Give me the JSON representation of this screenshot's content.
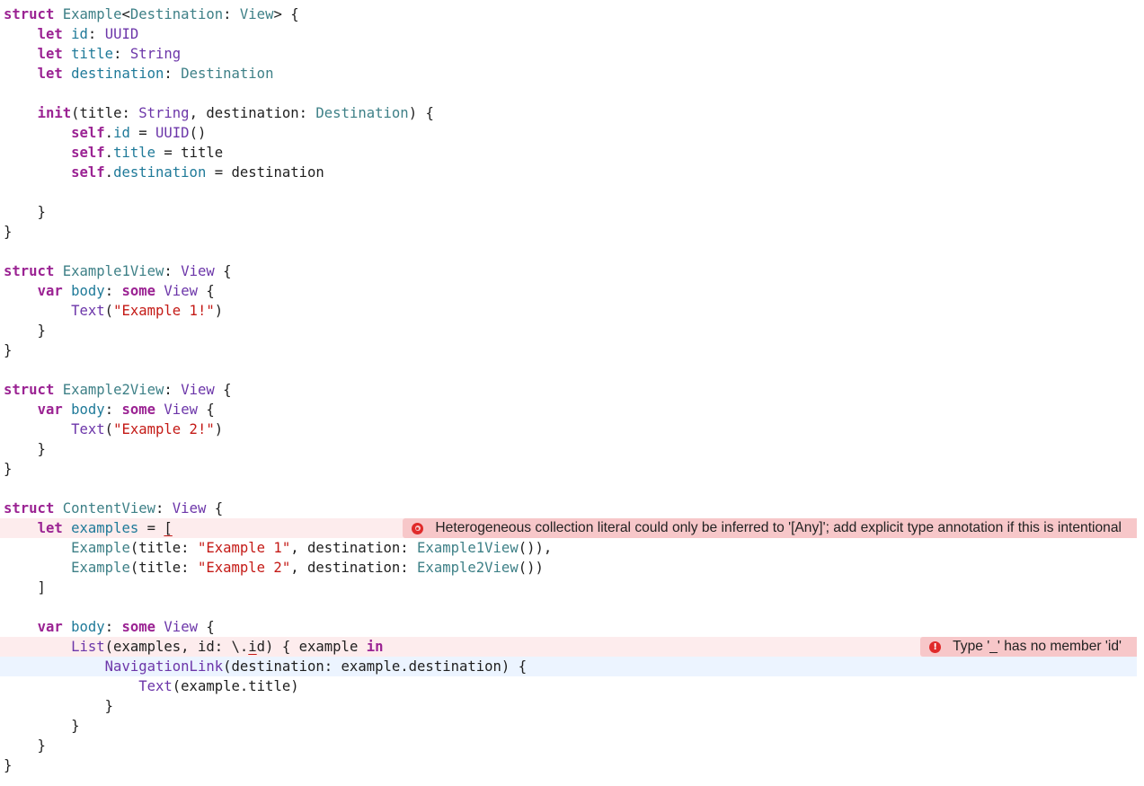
{
  "colors": {
    "keyword": "#9b2393",
    "type": "#3e8087",
    "property": "#1f7a99",
    "function": "#6c36a9",
    "string": "#c41a16",
    "plain": "#1f1f1f",
    "error_line_bg": "#fdeced",
    "current_line_bg": "#ecf4ff",
    "error_badge_bg": "#f7c7c9",
    "error_icon": "#e02a2a"
  },
  "code_lines": [
    {
      "tokens": [
        {
          "t": "kw",
          "v": "struct"
        },
        {
          "t": "plain",
          "v": " "
        },
        {
          "t": "type",
          "v": "Example"
        },
        {
          "t": "plain",
          "v": "<"
        },
        {
          "t": "type",
          "v": "Destination"
        },
        {
          "t": "plain",
          "v": ": "
        },
        {
          "t": "type",
          "v": "View"
        },
        {
          "t": "plain",
          "v": "> {"
        }
      ]
    },
    {
      "tokens": [
        {
          "t": "plain",
          "v": "    "
        },
        {
          "t": "kw",
          "v": "let"
        },
        {
          "t": "plain",
          "v": " "
        },
        {
          "t": "prop",
          "v": "id"
        },
        {
          "t": "plain",
          "v": ": "
        },
        {
          "t": "fn",
          "v": "UUID"
        }
      ]
    },
    {
      "tokens": [
        {
          "t": "plain",
          "v": "    "
        },
        {
          "t": "kw",
          "v": "let"
        },
        {
          "t": "plain",
          "v": " "
        },
        {
          "t": "prop",
          "v": "title"
        },
        {
          "t": "plain",
          "v": ": "
        },
        {
          "t": "fn",
          "v": "String"
        }
      ]
    },
    {
      "tokens": [
        {
          "t": "plain",
          "v": "    "
        },
        {
          "t": "kw",
          "v": "let"
        },
        {
          "t": "plain",
          "v": " "
        },
        {
          "t": "prop",
          "v": "destination"
        },
        {
          "t": "plain",
          "v": ": "
        },
        {
          "t": "type",
          "v": "Destination"
        }
      ]
    },
    {
      "tokens": []
    },
    {
      "tokens": [
        {
          "t": "plain",
          "v": "    "
        },
        {
          "t": "kw",
          "v": "init"
        },
        {
          "t": "plain",
          "v": "(title: "
        },
        {
          "t": "fn",
          "v": "String"
        },
        {
          "t": "plain",
          "v": ", destination: "
        },
        {
          "t": "type",
          "v": "Destination"
        },
        {
          "t": "plain",
          "v": ") {"
        }
      ]
    },
    {
      "tokens": [
        {
          "t": "plain",
          "v": "        "
        },
        {
          "t": "kw",
          "v": "self"
        },
        {
          "t": "plain",
          "v": "."
        },
        {
          "t": "prop",
          "v": "id"
        },
        {
          "t": "plain",
          "v": " = "
        },
        {
          "t": "fn",
          "v": "UUID"
        },
        {
          "t": "plain",
          "v": "()"
        }
      ]
    },
    {
      "tokens": [
        {
          "t": "plain",
          "v": "        "
        },
        {
          "t": "kw",
          "v": "self"
        },
        {
          "t": "plain",
          "v": "."
        },
        {
          "t": "prop",
          "v": "title"
        },
        {
          "t": "plain",
          "v": " = title"
        }
      ]
    },
    {
      "tokens": [
        {
          "t": "plain",
          "v": "        "
        },
        {
          "t": "kw",
          "v": "self"
        },
        {
          "t": "plain",
          "v": "."
        },
        {
          "t": "prop",
          "v": "destination"
        },
        {
          "t": "plain",
          "v": " = destination"
        }
      ]
    },
    {
      "tokens": []
    },
    {
      "tokens": [
        {
          "t": "plain",
          "v": "    }"
        }
      ]
    },
    {
      "tokens": [
        {
          "t": "plain",
          "v": "}"
        }
      ]
    },
    {
      "tokens": []
    },
    {
      "tokens": [
        {
          "t": "kw",
          "v": "struct"
        },
        {
          "t": "plain",
          "v": " "
        },
        {
          "t": "type",
          "v": "Example1View"
        },
        {
          "t": "plain",
          "v": ": "
        },
        {
          "t": "fn",
          "v": "View"
        },
        {
          "t": "plain",
          "v": " {"
        }
      ]
    },
    {
      "tokens": [
        {
          "t": "plain",
          "v": "    "
        },
        {
          "t": "kw",
          "v": "var"
        },
        {
          "t": "plain",
          "v": " "
        },
        {
          "t": "prop",
          "v": "body"
        },
        {
          "t": "plain",
          "v": ": "
        },
        {
          "t": "kw",
          "v": "some"
        },
        {
          "t": "plain",
          "v": " "
        },
        {
          "t": "fn",
          "v": "View"
        },
        {
          "t": "plain",
          "v": " {"
        }
      ]
    },
    {
      "tokens": [
        {
          "t": "plain",
          "v": "        "
        },
        {
          "t": "fn",
          "v": "Text"
        },
        {
          "t": "plain",
          "v": "("
        },
        {
          "t": "str",
          "v": "\"Example 1!\""
        },
        {
          "t": "plain",
          "v": ")"
        }
      ]
    },
    {
      "tokens": [
        {
          "t": "plain",
          "v": "    }"
        }
      ]
    },
    {
      "tokens": [
        {
          "t": "plain",
          "v": "}"
        }
      ]
    },
    {
      "tokens": []
    },
    {
      "tokens": [
        {
          "t": "kw",
          "v": "struct"
        },
        {
          "t": "plain",
          "v": " "
        },
        {
          "t": "type",
          "v": "Example2View"
        },
        {
          "t": "plain",
          "v": ": "
        },
        {
          "t": "fn",
          "v": "View"
        },
        {
          "t": "plain",
          "v": " {"
        }
      ]
    },
    {
      "tokens": [
        {
          "t": "plain",
          "v": "    "
        },
        {
          "t": "kw",
          "v": "var"
        },
        {
          "t": "plain",
          "v": " "
        },
        {
          "t": "prop",
          "v": "body"
        },
        {
          "t": "plain",
          "v": ": "
        },
        {
          "t": "kw",
          "v": "some"
        },
        {
          "t": "plain",
          "v": " "
        },
        {
          "t": "fn",
          "v": "View"
        },
        {
          "t": "plain",
          "v": " {"
        }
      ]
    },
    {
      "tokens": [
        {
          "t": "plain",
          "v": "        "
        },
        {
          "t": "fn",
          "v": "Text"
        },
        {
          "t": "plain",
          "v": "("
        },
        {
          "t": "str",
          "v": "\"Example 2!\""
        },
        {
          "t": "plain",
          "v": ")"
        }
      ]
    },
    {
      "tokens": [
        {
          "t": "plain",
          "v": "    }"
        }
      ]
    },
    {
      "tokens": [
        {
          "t": "plain",
          "v": "}"
        }
      ]
    },
    {
      "tokens": []
    },
    {
      "tokens": [
        {
          "t": "kw",
          "v": "struct"
        },
        {
          "t": "plain",
          "v": " "
        },
        {
          "t": "type",
          "v": "ContentView"
        },
        {
          "t": "plain",
          "v": ": "
        },
        {
          "t": "fn",
          "v": "View"
        },
        {
          "t": "plain",
          "v": " {"
        }
      ]
    },
    {
      "state": "error",
      "tokens": [
        {
          "t": "plain",
          "v": "    "
        },
        {
          "t": "kw",
          "v": "let"
        },
        {
          "t": "plain",
          "v": " "
        },
        {
          "t": "prop",
          "v": "examples"
        },
        {
          "t": "plain",
          "v": " = "
        },
        {
          "t": "cursor",
          "v": "["
        }
      ],
      "annotation": {
        "icon": "error-circle-icon",
        "text": "Heterogeneous collection literal could only be inferred to '[Any]'; add explicit type annotation if this is intentional"
      }
    },
    {
      "tokens": [
        {
          "t": "plain",
          "v": "        "
        },
        {
          "t": "type",
          "v": "Example"
        },
        {
          "t": "plain",
          "v": "(title: "
        },
        {
          "t": "str",
          "v": "\"Example 1\""
        },
        {
          "t": "plain",
          "v": ", destination: "
        },
        {
          "t": "type",
          "v": "Example1View"
        },
        {
          "t": "plain",
          "v": "()),"
        }
      ]
    },
    {
      "tokens": [
        {
          "t": "plain",
          "v": "        "
        },
        {
          "t": "type",
          "v": "Example"
        },
        {
          "t": "plain",
          "v": "(title: "
        },
        {
          "t": "str",
          "v": "\"Example 2\""
        },
        {
          "t": "plain",
          "v": ", destination: "
        },
        {
          "t": "type",
          "v": "Example2View"
        },
        {
          "t": "plain",
          "v": "())"
        }
      ]
    },
    {
      "tokens": [
        {
          "t": "plain",
          "v": "    ]"
        }
      ]
    },
    {
      "tokens": []
    },
    {
      "tokens": [
        {
          "t": "plain",
          "v": "    "
        },
        {
          "t": "kw",
          "v": "var"
        },
        {
          "t": "plain",
          "v": " "
        },
        {
          "t": "prop",
          "v": "body"
        },
        {
          "t": "plain",
          "v": ": "
        },
        {
          "t": "kw",
          "v": "some"
        },
        {
          "t": "plain",
          "v": " "
        },
        {
          "t": "fn",
          "v": "View"
        },
        {
          "t": "plain",
          "v": " {"
        }
      ]
    },
    {
      "state": "error",
      "tokens": [
        {
          "t": "plain",
          "v": "        "
        },
        {
          "t": "fn",
          "v": "List"
        },
        {
          "t": "plain",
          "v": "(examples, id: \\."
        },
        {
          "t": "cursor",
          "v": "i"
        },
        {
          "t": "plain",
          "v": "d) { example "
        },
        {
          "t": "kw2",
          "v": "in"
        }
      ],
      "annotation": {
        "icon": "error-exclamation-icon",
        "text": "Type '_' has no member 'id'"
      }
    },
    {
      "state": "current",
      "tokens": [
        {
          "t": "plain",
          "v": "            "
        },
        {
          "t": "fn",
          "v": "NavigationLink"
        },
        {
          "t": "plain",
          "v": "(destination: example.destination) {"
        }
      ]
    },
    {
      "tokens": [
        {
          "t": "plain",
          "v": "                "
        },
        {
          "t": "fn",
          "v": "Text"
        },
        {
          "t": "plain",
          "v": "(example.title)"
        }
      ]
    },
    {
      "tokens": [
        {
          "t": "plain",
          "v": "            }"
        }
      ]
    },
    {
      "tokens": [
        {
          "t": "plain",
          "v": "        }"
        }
      ]
    },
    {
      "tokens": [
        {
          "t": "plain",
          "v": "    }"
        }
      ]
    },
    {
      "tokens": [
        {
          "t": "plain",
          "v": "}"
        }
      ]
    }
  ]
}
